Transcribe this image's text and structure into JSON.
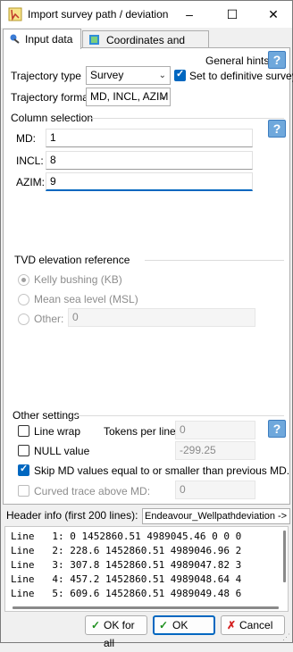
{
  "window": {
    "title": "Import survey path / deviation",
    "minimize": "–",
    "maximize": "☐",
    "close": "✕"
  },
  "tabs": [
    {
      "label": "Input data",
      "active": true
    },
    {
      "label": "Coordinates and units",
      "active": false
    }
  ],
  "input_data": {
    "general_hints_label": "General hints:",
    "trajectory_type_label": "Trajectory type",
    "trajectory_type_value": "Survey",
    "set_definitive_label": "Set to definitive survey",
    "set_definitive_checked": true,
    "trajectory_format_label": "Trajectory format",
    "trajectory_format_value": "MD, INCL, AZIM",
    "column_selection_title": "Column selection",
    "md_label": "MD:",
    "md_value": "1",
    "incl_label": "INCL:",
    "incl_value": "8",
    "azim_label": "AZIM:",
    "azim_value": "9",
    "tvd_title": "TVD elevation reference",
    "kb_label": "Kelly bushing (KB)",
    "msl_label": "Mean sea level (MSL)",
    "other_label": "Other:",
    "other_value": "0",
    "other_settings_title": "Other settings",
    "line_wrap_label": "Line wrap",
    "line_wrap_checked": false,
    "tokens_per_line_label": "Tokens per line:",
    "tokens_per_line_value": "0",
    "null_value_label": "NULL value",
    "null_value_checked": false,
    "null_value": "-299.25",
    "skip_md_label": "Skip MD values equal to or smaller than previous MD.",
    "skip_md_checked": true,
    "curved_trace_label": "Curved trace above MD:",
    "curved_trace_value": "0",
    "help_glyph": "?"
  },
  "header_info": {
    "label": "Header info (first 200 lines):",
    "file_name": "Endeavour_Wellpathdeviation -> Su",
    "lines": [
      "Line   1: 0 1452860.51 4989045.46 0 0 0",
      "Line   2: 228.6 1452860.51 4989046.96 2",
      "Line   3: 307.8 1452860.51 4989047.82 3",
      "Line   4: 457.2 1452860.51 4989048.64 4",
      "Line   5: 609.6 1452860.51 4989049.48 6"
    ]
  },
  "buttons": {
    "ok_for_all": "OK for all",
    "ok": "OK",
    "cancel": "Cancel"
  },
  "colors": {
    "accent": "#0067c0",
    "check_green": "#1e8f1e",
    "cancel_red": "#d42020"
  }
}
